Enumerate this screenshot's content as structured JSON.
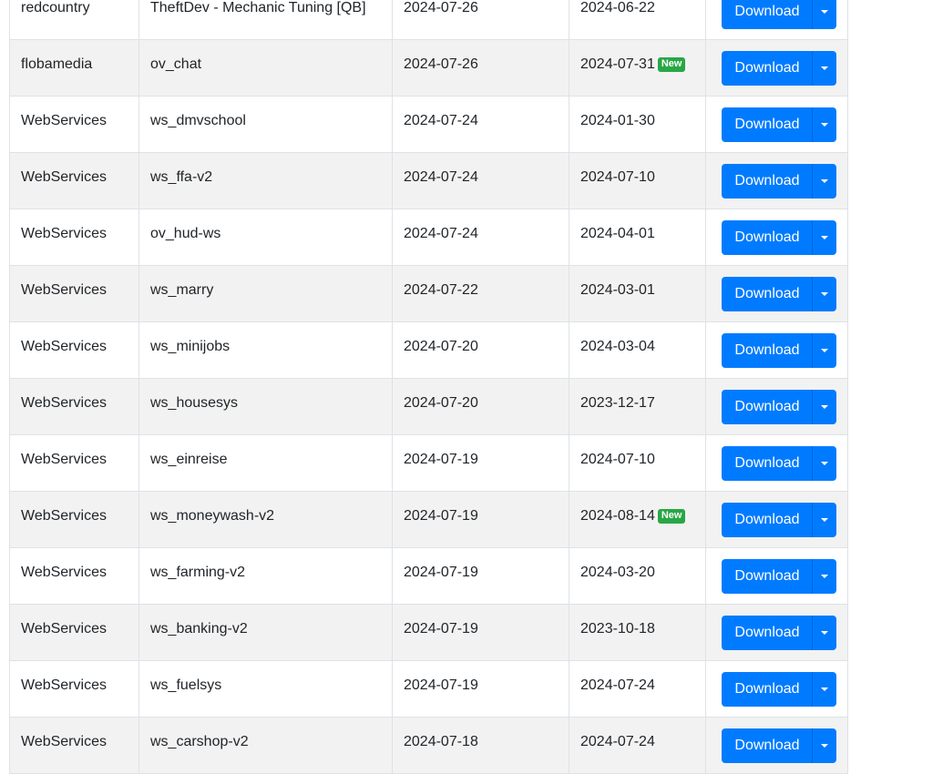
{
  "table": {
    "rows": [
      {
        "author": "redcountry",
        "name": "TheftDev - Mechanic Tuning [QB]",
        "uploaded": "2024-07-26",
        "updated": "2024-06-22",
        "new": false
      },
      {
        "author": "flobamedia",
        "name": "ov_chat",
        "uploaded": "2024-07-26",
        "updated": "2024-07-31",
        "new": true
      },
      {
        "author": "WebServices",
        "name": "ws_dmvschool",
        "uploaded": "2024-07-24",
        "updated": "2024-01-30",
        "new": false
      },
      {
        "author": "WebServices",
        "name": "ws_ffa-v2",
        "uploaded": "2024-07-24",
        "updated": "2024-07-10",
        "new": false
      },
      {
        "author": "WebServices",
        "name": "ov_hud-ws",
        "uploaded": "2024-07-24",
        "updated": "2024-04-01",
        "new": false
      },
      {
        "author": "WebServices",
        "name": "ws_marry",
        "uploaded": "2024-07-22",
        "updated": "2024-03-01",
        "new": false
      },
      {
        "author": "WebServices",
        "name": "ws_minijobs",
        "uploaded": "2024-07-20",
        "updated": "2024-03-04",
        "new": false
      },
      {
        "author": "WebServices",
        "name": "ws_housesys",
        "uploaded": "2024-07-20",
        "updated": "2023-12-17",
        "new": false
      },
      {
        "author": "WebServices",
        "name": "ws_einreise",
        "uploaded": "2024-07-19",
        "updated": "2024-07-10",
        "new": false
      },
      {
        "author": "WebServices",
        "name": "ws_moneywash-v2",
        "uploaded": "2024-07-19",
        "updated": "2024-08-14",
        "new": true
      },
      {
        "author": "WebServices",
        "name": "ws_farming-v2",
        "uploaded": "2024-07-19",
        "updated": "2024-03-20",
        "new": false
      },
      {
        "author": "WebServices",
        "name": "ws_banking-v2",
        "uploaded": "2024-07-19",
        "updated": "2023-10-18",
        "new": false
      },
      {
        "author": "WebServices",
        "name": "ws_fuelsys",
        "uploaded": "2024-07-19",
        "updated": "2024-07-24",
        "new": false
      },
      {
        "author": "WebServices",
        "name": "ws_carshop-v2",
        "uploaded": "2024-07-18",
        "updated": "2024-07-24",
        "new": false
      }
    ],
    "download_label": "Download",
    "new_badge_label": "New"
  },
  "colors": {
    "primary": "#007bff",
    "badge_new": "#28a745",
    "stripe": "#f2f2f2",
    "border": "#dee2e6"
  },
  "icons": {
    "dropdown_toggle": "caret-down-icon"
  }
}
